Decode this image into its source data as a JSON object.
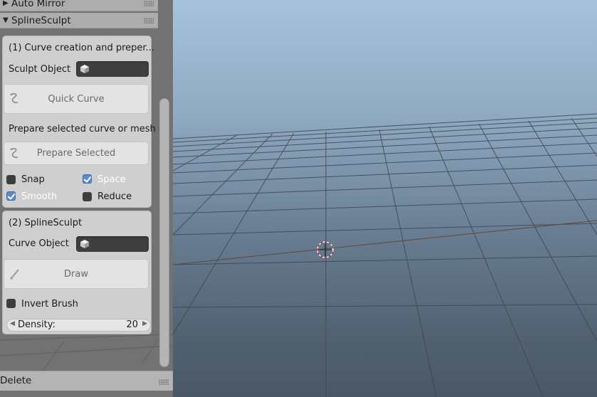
{
  "panels": {
    "auto_mirror": {
      "title": "Auto Mirror",
      "expanded": false
    },
    "splinesculpt": {
      "title": "SplineSculpt",
      "expanded": true
    },
    "delete": {
      "title": "Delete"
    }
  },
  "section1": {
    "title": "(1) Curve creation and preper...",
    "sculpt_object_label": "Sculpt Object",
    "sculpt_object_value": "",
    "quick_curve_label": "Quick Curve",
    "prepare_text": "Prepare selected curve or mesh",
    "prepare_selected_label": "Prepare Selected",
    "options": {
      "snap": {
        "label": "Snap",
        "checked": false
      },
      "space": {
        "label": "Space",
        "checked": true
      },
      "smooth": {
        "label": "Smooth",
        "checked": true
      },
      "reduce": {
        "label": "Reduce",
        "checked": false
      }
    }
  },
  "section2": {
    "title": "(2) SplineSculpt",
    "curve_object_label": "Curve Object",
    "curve_object_value": "",
    "draw_label": "Draw",
    "invert_brush": {
      "label": "Invert Brush",
      "checked": false
    },
    "density": {
      "label": "Density:",
      "value": "20"
    }
  },
  "icons": {
    "panel_expanded": "triangle-down-icon",
    "panel_collapsed": "triangle-right-icon",
    "object": "cube-icon",
    "curve_tool": "curve-icon",
    "draw_tool": "brush-icon",
    "cursor": "3d-cursor-icon"
  },
  "colors": {
    "checkbox_on": "#5b8bc7",
    "field_dark": "#3f3f3f",
    "panel_bg": "#cfcfcf"
  }
}
